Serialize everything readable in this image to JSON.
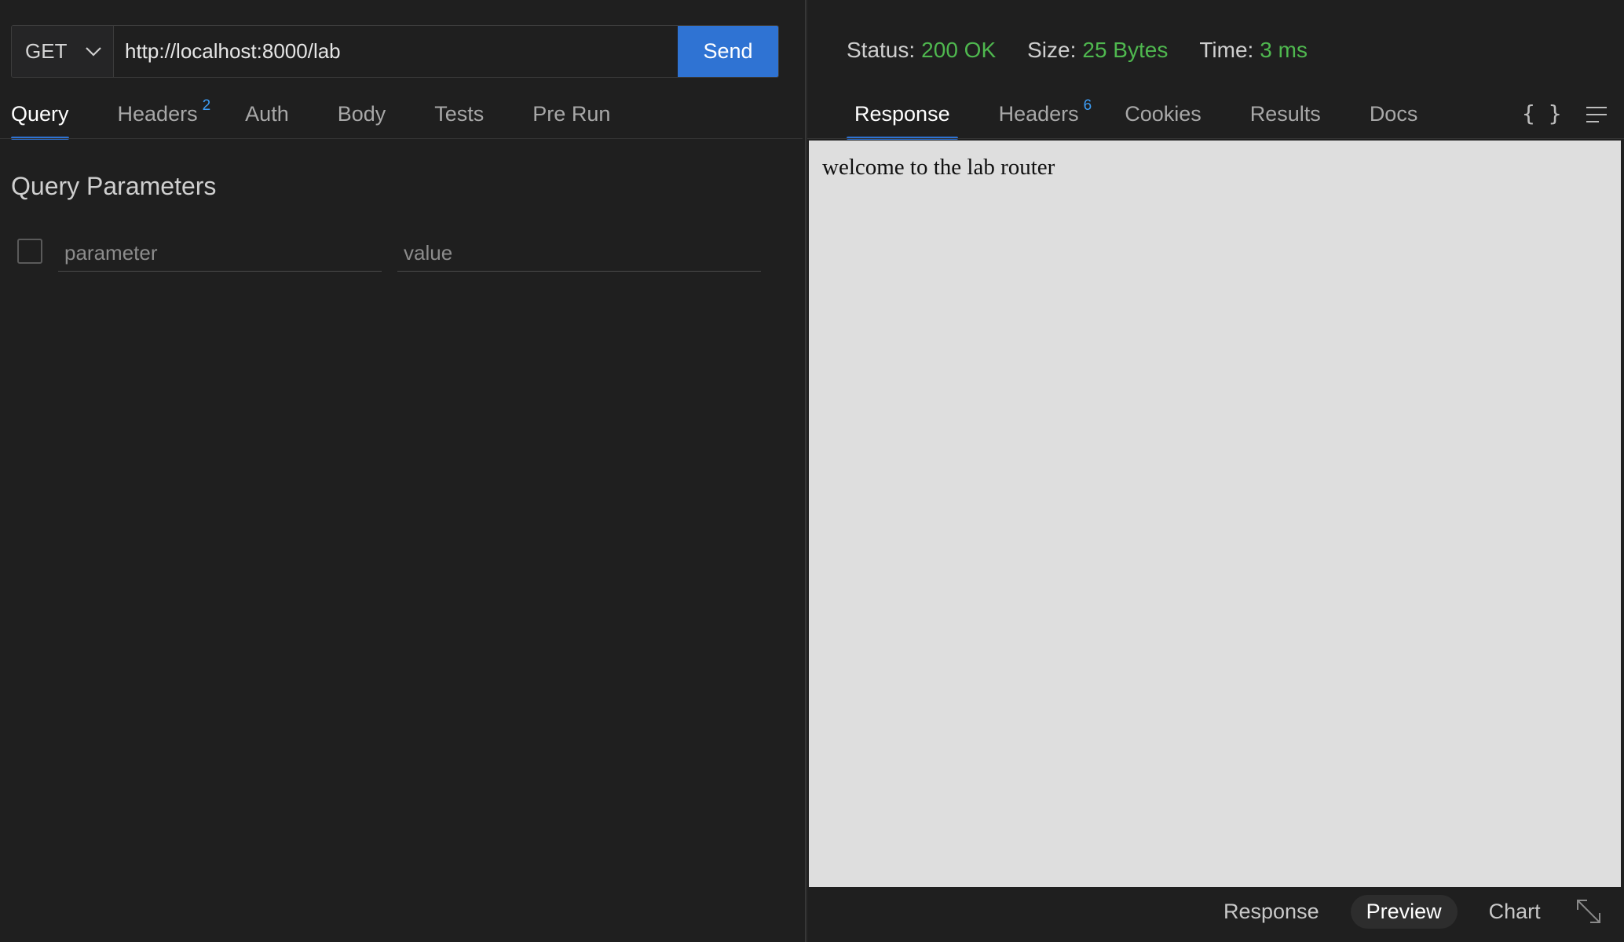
{
  "request": {
    "method": "GET",
    "url": "http://localhost:8000/lab",
    "send_label": "Send"
  },
  "request_tabs": [
    {
      "label": "Query",
      "badge": "",
      "active": true
    },
    {
      "label": "Headers",
      "badge": "2",
      "active": false
    },
    {
      "label": "Auth",
      "badge": "",
      "active": false
    },
    {
      "label": "Body",
      "badge": "",
      "active": false
    },
    {
      "label": "Tests",
      "badge": "",
      "active": false
    },
    {
      "label": "Pre Run",
      "badge": "",
      "active": false
    }
  ],
  "query": {
    "title": "Query Parameters",
    "param_placeholder": "parameter",
    "value_placeholder": "value"
  },
  "response_status": {
    "status_label": "Status:",
    "status_value": "200 OK",
    "size_label": "Size:",
    "size_value": "25 Bytes",
    "time_label": "Time:",
    "time_value": "3 ms"
  },
  "response_tabs": [
    {
      "label": "Response",
      "badge": "",
      "active": true
    },
    {
      "label": "Headers",
      "badge": "6",
      "active": false
    },
    {
      "label": "Cookies",
      "badge": "",
      "active": false
    },
    {
      "label": "Results",
      "badge": "",
      "active": false
    },
    {
      "label": "Docs",
      "badge": "",
      "active": false
    }
  ],
  "toolbar_icons": {
    "format": "braces-icon",
    "wrap": "lines-icon",
    "expand": "expand-icon",
    "method_dropdown": "chevron-down-icon"
  },
  "preview": {
    "body_text": "welcome to the lab router"
  },
  "view_modes": {
    "response": "Response",
    "preview": "Preview",
    "chart": "Chart",
    "selected": "Preview"
  },
  "colors": {
    "accent": "#2f73d3",
    "success": "#4fb84f",
    "badge": "#3d9df5"
  }
}
